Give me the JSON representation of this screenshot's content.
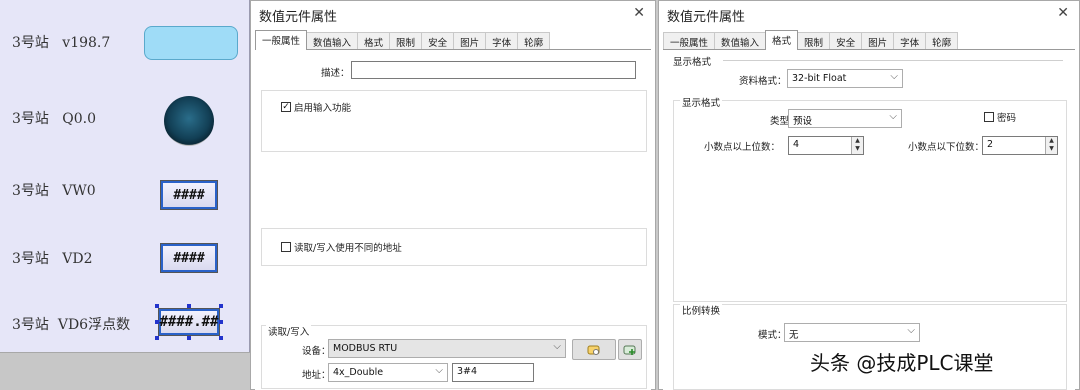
{
  "hmi": {
    "rows": [
      {
        "station": "3号站",
        "label": "v198.7"
      },
      {
        "station": "3号站",
        "label": "Q0.0"
      },
      {
        "station": "3号站",
        "label": "VW0",
        "value": "####"
      },
      {
        "station": "3号站",
        "label": "VD2",
        "value": "####"
      },
      {
        "station": "3号站",
        "label": "VD6浮点数",
        "value": "####.##"
      }
    ],
    "colors": {
      "indicator_blue": "#9fdcf7",
      "lamp_dark": "#123f55",
      "selection": "#2233cc"
    }
  },
  "dialog1": {
    "title": "数值元件属性",
    "close_icon": "close-icon",
    "tabs": [
      "一般属性",
      "数值输入",
      "格式",
      "限制",
      "安全",
      "图片",
      "字体",
      "轮廓"
    ],
    "active_tab": "一般属性",
    "description_label": "描述：",
    "description_value": "",
    "enable_input_label": "启用输入功能",
    "enable_input_checked": true,
    "rw_diff_label": "读取/写入使用不同的地址",
    "rw_diff_checked": false,
    "rw_group_label": "读取/写入",
    "device_label": "设备：",
    "device_value": "MODBUS RTU",
    "address_label": "地址：",
    "address_type": "4x_Double",
    "address_value": "3#4"
  },
  "dialog2": {
    "title": "数值元件属性",
    "close_icon": "close-icon",
    "tabs": [
      "一般属性",
      "数值输入",
      "格式",
      "限制",
      "安全",
      "图片",
      "字体",
      "轮廓"
    ],
    "active_tab": "格式",
    "display_format_group": "显示格式",
    "data_format_label": "资料格式：",
    "data_format_value": "32-bit Float",
    "display_group": "显示格式",
    "type_label": "类型：",
    "type_value": "预设",
    "password_label": "密码",
    "password_checked": false,
    "int_digits_label": "小数点以上位数：",
    "int_digits_value": "4",
    "frac_digits_label": "小数点以下位数：",
    "frac_digits_value": "2",
    "scale_group": "比例转换",
    "mode_label": "模式：",
    "mode_value": "无"
  },
  "watermark": "头条 @技成PLC课堂"
}
